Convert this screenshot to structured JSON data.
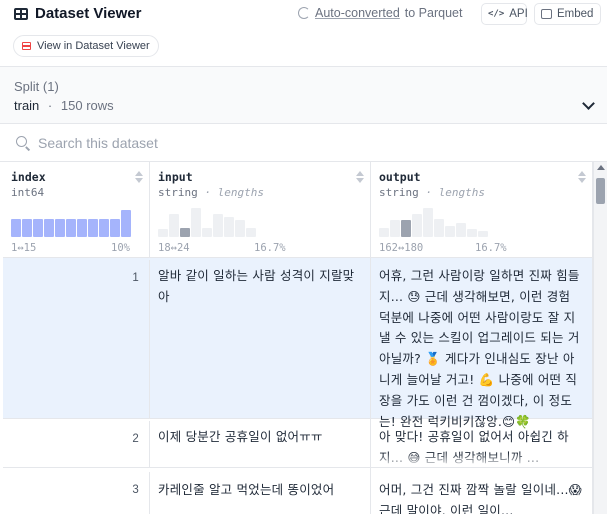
{
  "header": {
    "title": "Dataset Viewer",
    "auto_converted_link": "Auto-converted",
    "auto_converted_suffix": "to Parquet",
    "api_label": "API",
    "api_icon_text": "</>",
    "embed_label": "Embed",
    "view_button_label": "View in Dataset Viewer"
  },
  "split": {
    "label": "Split (1)",
    "name": "train",
    "separator": "·",
    "rows": "150 rows"
  },
  "search": {
    "placeholder": "Search this dataset",
    "value": ""
  },
  "columns": [
    {
      "name": "index",
      "type": "int64",
      "stat": "",
      "range": "1↔15",
      "pct": "10%",
      "histogram": [
        0.6,
        0.6,
        0.6,
        0.6,
        0.6,
        0.6,
        0.6,
        0.6,
        0.6,
        0.6,
        0.9
      ],
      "histogram_active": [
        true,
        true,
        true,
        true,
        true,
        true,
        true,
        true,
        true,
        true,
        true
      ]
    },
    {
      "name": "input",
      "type": "string",
      "stat": "lengths",
      "range": "18↔24",
      "pct": "16.7%",
      "histogram": [
        0.25,
        0.75,
        0.3,
        0.95,
        0.3,
        0.75,
        0.65,
        0.55,
        0.3
      ],
      "histogram_active": [
        false,
        false,
        true,
        false,
        false,
        false,
        false,
        false,
        false
      ]
    },
    {
      "name": "output",
      "type": "string",
      "stat": "lengths",
      "range": "162↔180",
      "pct": "16.7%",
      "histogram": [
        0.3,
        0.55,
        0.55,
        0.75,
        0.95,
        0.6,
        0.35,
        0.45,
        0.25,
        0.2
      ],
      "histogram_active": [
        false,
        false,
        true,
        false,
        false,
        false,
        false,
        false,
        false,
        false
      ]
    }
  ],
  "rows": [
    {
      "index": "1",
      "input": "알바 같이 일하는 사람 성격이 지랄맞아",
      "output": "어휴, 그런 사람이랑 일하면 진짜 힘들지... 😓 근데 생각해보면, 이런 경험 덕분에 나중에 어떤 사람이랑도 잘 지낼 수 있는 스킬이 업그레이드 되는 거 아닐까? 🏅 게다가 인내심도 장난 아니게 늘어날 거고! 💪 나중에 어떤 직장을 가도 이런 건 껌이겠다, 이 정도는! 완전 럭키비키잖앙.😊🍀"
    },
    {
      "index": "2",
      "input": "이제 당분간 공휴일이 없어ㅠㅠ",
      "output": "아 맞다! 공휴일이 없어서 아쉽긴 하지... 😅 근데 생각해보니까 ..."
    },
    {
      "index": "3",
      "input": "카레인줄 알고 먹었는데 똥이었어",
      "output": "어머, 그건 진짜 깜짝 놀랄 일이네...😱 근데 말이야, 이런 일이..."
    }
  ],
  "colors": {
    "selected_row": "#eaf2fd",
    "hist_active_index": "#a5b4fc",
    "hist_active_string": "#9ca3af",
    "hist_inactive": "#eef0f3"
  }
}
